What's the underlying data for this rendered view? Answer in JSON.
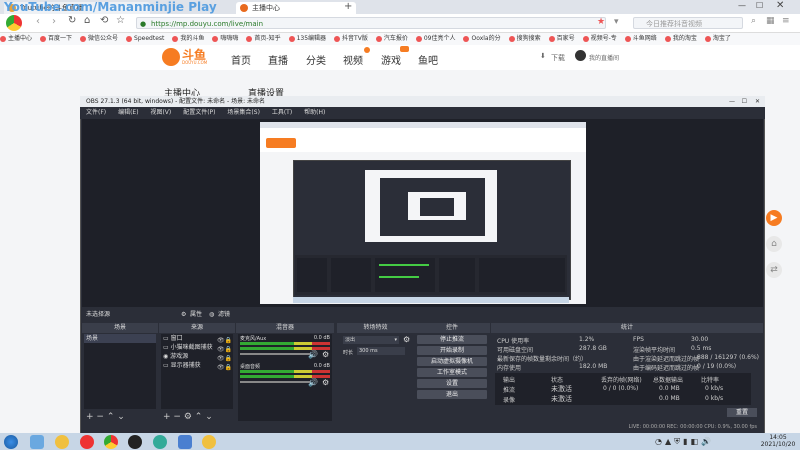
{
  "watermark": "YouTube.com/Mananminjie Play",
  "browser": {
    "tabs": [
      {
        "label": "Youtube的斗鱼直播",
        "color": "#e8a23a"
      },
      {
        "label": "主播中心",
        "color": "#e86a1e",
        "active": true
      }
    ],
    "url": "https://mp.douyu.com/live/main",
    "search_placeholder": "今日推荐抖音视频",
    "bookmarks": [
      "主播中心",
      "百度一下",
      "微信公众号",
      "Speedtest",
      "我的斗鱼",
      "嗨嗨嗨",
      "首页-知乎",
      "135编辑器",
      "抖音TV版",
      "汽车报价",
      "09佳亮个人",
      "Ooxla的分",
      "搜狗搜索",
      "百家号",
      "视频号-专",
      "斗鱼网络",
      "我的淘宝",
      "淘宝了"
    ]
  },
  "douyu": {
    "logo_text": "斗鱼",
    "logo_sub": "DOUYU.COM",
    "nav": [
      "首页",
      "直播",
      "分类",
      "视频",
      "游戏",
      "鱼吧"
    ],
    "download_label": "下载",
    "user_label": "我的直播间",
    "sidebar_title": "主播中心",
    "page_title": "直播设置"
  },
  "obs": {
    "title": "OBS 27.1.3 (64 bit, windows) - 配置文件: 未命名 - 场景: 未命名",
    "menu": [
      "文件(F)",
      "编辑(E)",
      "视图(V)",
      "配置文件(P)",
      "场景集合(S)",
      "工具(T)",
      "帮助(H)"
    ],
    "scene_bar": {
      "current_scene": "未选择源",
      "properties": "属性",
      "filters": "滤镜"
    },
    "docks": {
      "scenes": {
        "title": "场景",
        "items": [
          "场景"
        ]
      },
      "sources": {
        "title": "来源",
        "items": [
          "窗口",
          "小猫咪截图捕获",
          "游戏源",
          "显示器捕获"
        ]
      },
      "mixer": {
        "title": "混音器",
        "tracks": [
          {
            "name": "麦克风/Aux",
            "db": "0.0 dB"
          },
          {
            "name": "桌面音频",
            "db": "0.0 dB"
          }
        ]
      },
      "transitions": {
        "title": "转场特效",
        "type": "淡出",
        "duration_label": "时长",
        "duration": "300 ms"
      },
      "controls": {
        "title": "控件",
        "buttons": [
          "停止推流",
          "开始录制",
          "启动虚拟摄像机",
          "工作室模式",
          "设置",
          "退出"
        ]
      },
      "stats": {
        "title": "统计",
        "rows": [
          {
            "label": "CPU 使用率",
            "value": "1.2%",
            "label2": "FPS",
            "value2": "30.00"
          },
          {
            "label": "可用磁盘空间",
            "value": "287.8 GB",
            "label2": "渲染帧平均时间",
            "value2": "0.5 ms"
          },
          {
            "label": "最新保存的帧数量剩余时间（约）",
            "value": "",
            "label2": "由于渲染延迟而跳过的帧",
            "value2": "888 / 161297 (0.6%)"
          },
          {
            "label": "内存使用",
            "value": "182.0 MB",
            "label2": "由于编码延迟而跳过的帧",
            "value2": "0 / 19 (0.0%)"
          }
        ],
        "table_headers": [
          "输出",
          "状态",
          "丢弃的帧(网络)",
          "总数据输出",
          "比特率"
        ],
        "table_rows": [
          [
            "推流",
            "未激活",
            "0 / 0 (0.0%)",
            "0.0 MB",
            "0 kb/s"
          ],
          [
            "录像",
            "未激活",
            "",
            "0.0 MB",
            "0 kb/s"
          ]
        ],
        "reset_label": "重置"
      }
    },
    "status_bar": "LIVE: 00:00:00    REC: 00:00:00    CPU: 0.9%, 30.00 fps"
  },
  "taskbar": {
    "time": "14:05",
    "date": "2021/10/20"
  }
}
